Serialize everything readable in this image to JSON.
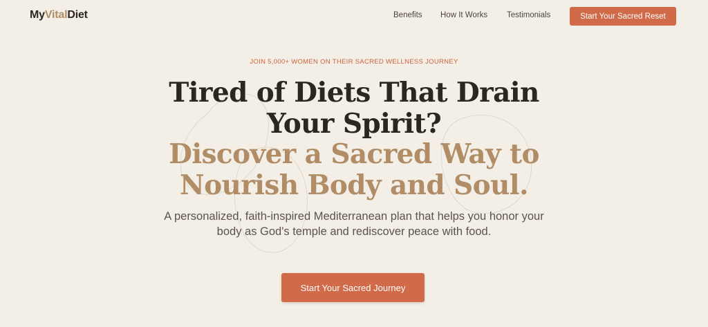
{
  "brand": {
    "name_part1": "My",
    "name_part2": "Vital",
    "name_part3": "Diet"
  },
  "nav": {
    "links": [
      "Benefits",
      "How It Works",
      "Testimonials"
    ],
    "cta_label": "Start Your Sacred Reset"
  },
  "hero": {
    "eyebrow": "JOIN 5,000+ WOMEN ON THEIR SACRED WELLNESS JOURNEY",
    "headline": "Tired of Diets That Drain Your Spirit?",
    "headline_accent": "Discover a Sacred Way to Nourish Body and Soul.",
    "subtext": "A personalized, faith-inspired Mediterranean plan that helps you honor your body as God's temple and rediscover peace with food.",
    "cta_label": "Start Your Sacred Journey"
  },
  "colors": {
    "background": "#f4efe6",
    "accent_orange": "#d06a48",
    "accent_tan": "#b08d66",
    "text_dark": "#2b2621"
  }
}
